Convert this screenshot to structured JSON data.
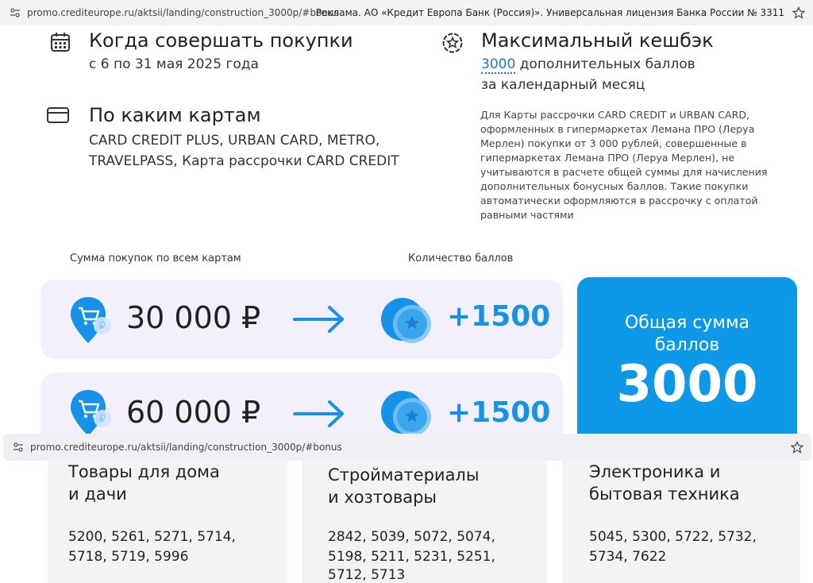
{
  "browser_top": {
    "url": "promo.crediteurope.ru/aktsii/landing/construction_3000p/#bonus",
    "ad_text": "Реклама. АО «Кредит Европа Банк (Россия)». Универсальная лицензия Банка России № 3311"
  },
  "when": {
    "title": "Когда совершать покупки",
    "text": "с 6 по 31 мая 2025 года",
    "icon": "calendar-icon"
  },
  "cards": {
    "title": "По каким картам",
    "line1": "CARD CREDIT PLUS, URBAN CARD, METRO,",
    "line2": "TRAVELPASS, Карта рассрочки CARD CREDIT",
    "icon": "credit-card-icon"
  },
  "cashback": {
    "title": "Максимальный кешбэк",
    "amount": "3000",
    "line1_rest": " дополнительных баллов",
    "line2": "за календарный месяц",
    "icon": "star-badge-icon",
    "note": "Для Карты рассрочки CARD CREDIT и URBAN CARD, оформленных в гипермаркетах Лемана ПРО (Леруа Мерлен) покупки от 3 000 рублей, совершенные в гипермаркетах Лемана ПРО (Леруа Мерлен), не учитываются в расчете общей суммы для начисления дополнительных бонусных баллов. Такие покупки автоматически оформляются в рассрочку с оплатой равными частями"
  },
  "tiers": {
    "label_sum": "Сумма покупок по всем картам",
    "label_points": "Количество баллов",
    "items": [
      {
        "amount": "30 000 ₽",
        "points": "+1500"
      },
      {
        "amount": "60 000 ₽",
        "points": "+1500"
      }
    ]
  },
  "total": {
    "label": "Общая сумма баллов",
    "value": "3000"
  },
  "browser_mid": {
    "url": "promo.crediteurope.ru/aktsii/landing/construction_3000p/#bonus"
  },
  "categories": [
    {
      "title1": "Товары для дома",
      "title2": "и дачи",
      "codes1": "5200, 5261, 5271, 5714,",
      "codes2": "5718, 5719, 5996",
      "codes3": ""
    },
    {
      "title1": "Стройматериалы",
      "title2": "и хозтовары",
      "codes1": "2842, 5039, 5072, 5074,",
      "codes2": "5198, 5211, 5231, 5251,",
      "codes3": "5712, 5713"
    },
    {
      "title1": "Электроника и",
      "title2": "бытовая техника",
      "codes1": "5045, 5300, 5722, 5732,",
      "codes2": "5734, 7622",
      "codes3": ""
    }
  ],
  "colors": {
    "accent": "#1693e8",
    "card_bg": "#0d98e8",
    "tier_bg": "#f4f0fb"
  }
}
